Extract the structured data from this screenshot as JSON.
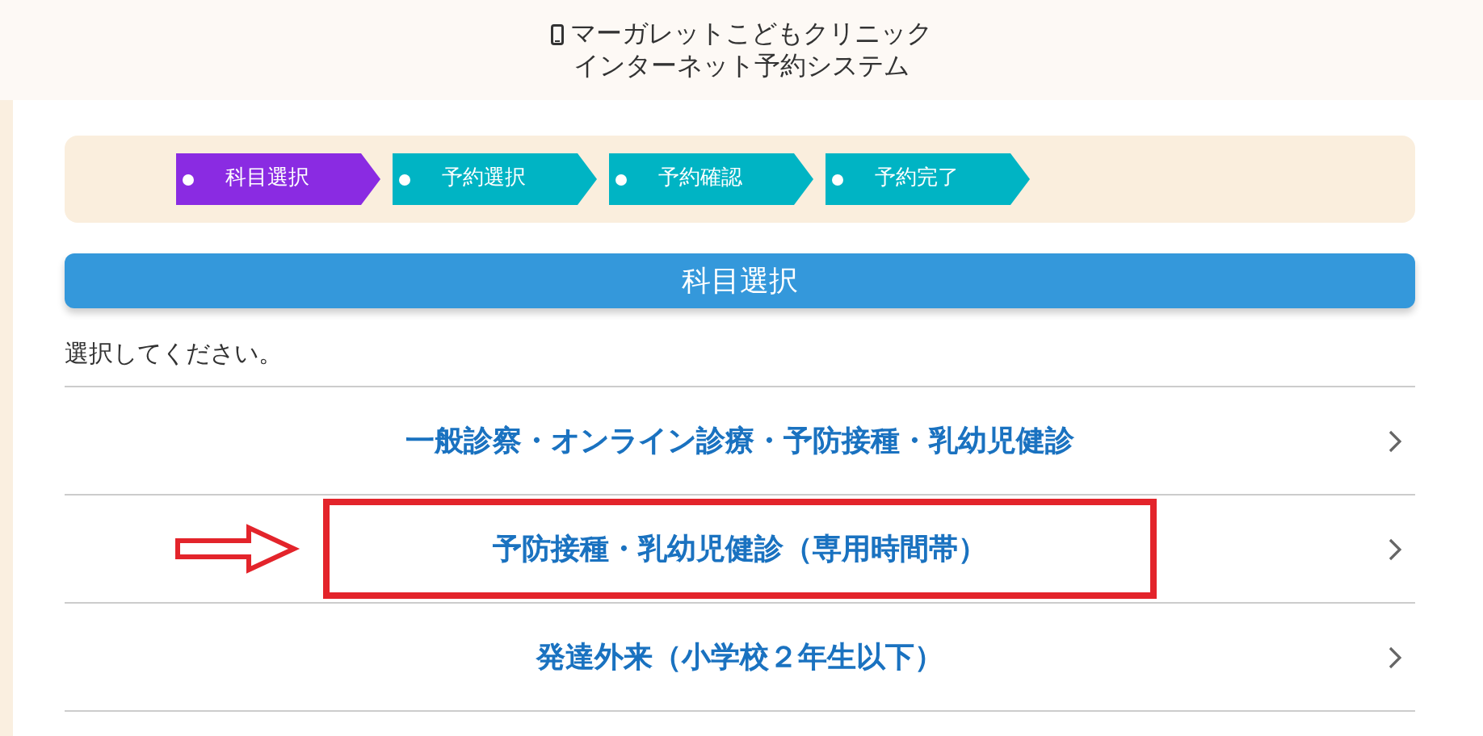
{
  "header": {
    "clinic": "マーガレットこどもクリニック",
    "system": "インターネット予約システム"
  },
  "steps": [
    {
      "label": "科目選択",
      "selected": true
    },
    {
      "label": "予約選択",
      "selected": false
    },
    {
      "label": "予約確認",
      "selected": false
    },
    {
      "label": "予約完了",
      "selected": false
    }
  ],
  "section_title": "科目選択",
  "instruction": "選択してください。",
  "departments": [
    {
      "label": "一般診察・オンライン診療・予防接種・乳幼児健診",
      "highlighted": false
    },
    {
      "label": "予防接種・乳幼児健診（専用時間帯）",
      "highlighted": true
    },
    {
      "label": "発達外来（小学校２年生以下）",
      "highlighted": false
    }
  ]
}
